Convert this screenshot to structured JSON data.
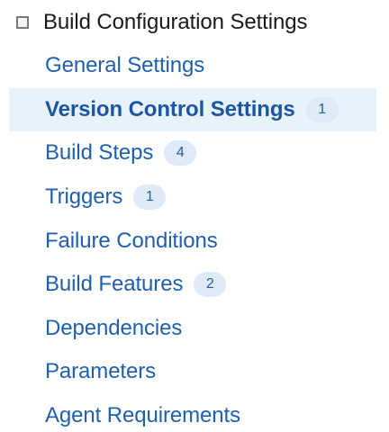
{
  "section": {
    "title": "Build Configuration Settings"
  },
  "nav": {
    "items": [
      {
        "label": "General Settings",
        "count": null,
        "selected": false
      },
      {
        "label": "Version Control Settings",
        "count": "1",
        "selected": true
      },
      {
        "label": "Build Steps",
        "count": "4",
        "selected": false
      },
      {
        "label": "Triggers",
        "count": "1",
        "selected": false
      },
      {
        "label": "Failure Conditions",
        "count": null,
        "selected": false
      },
      {
        "label": "Build Features",
        "count": "2",
        "selected": false
      },
      {
        "label": "Dependencies",
        "count": null,
        "selected": false
      },
      {
        "label": "Parameters",
        "count": null,
        "selected": false
      },
      {
        "label": "Agent Requirements",
        "count": null,
        "selected": false
      }
    ]
  },
  "colors": {
    "link": "#1f5fae",
    "selected_background": "#e8f2fb",
    "badge_background": "#deebf7"
  }
}
